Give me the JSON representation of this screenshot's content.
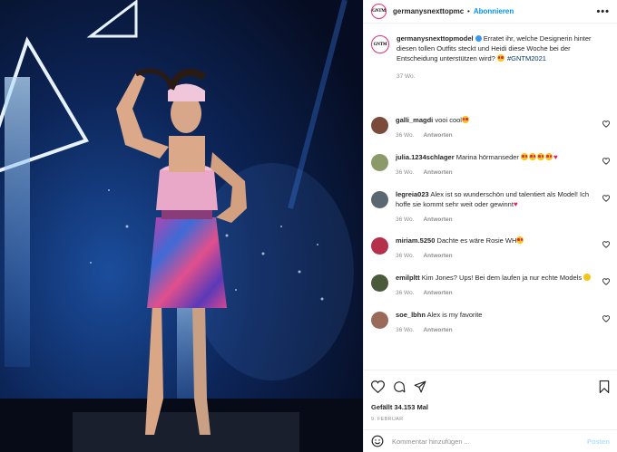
{
  "post": {
    "account": "germanysnexttopmc",
    "account_full": "germanysnexttopmodel",
    "logo_text": "GNTM",
    "follow_label": "Abonnieren",
    "more_label": "•••",
    "caption_text": " Erratet ihr, welche Designerin hinter diesen tollen Outfits steckt und Heidi diese Woche bei der Entscheidung unterstützen wird? ",
    "caption_tag": "#GNTM2021",
    "caption_time": "37 Wo."
  },
  "comments": [
    {
      "user": "galli_magdi",
      "text": " vooi cool",
      "emoji": [
        "eyes"
      ],
      "time": "36 Wo.",
      "reply": "Antworten",
      "avatar": "#7a4b3a"
    },
    {
      "user": "julia.1234schlager",
      "text": " Marina hörmanseder ",
      "emoji": [
        "eyes",
        "eyes",
        "eyes",
        "eyes",
        "heart"
      ],
      "time": "36 Wo.",
      "reply": "Antworten",
      "avatar": "#8c9a6a"
    },
    {
      "user": "legreia023",
      "text": " Alex ist so wunderschön und talentiert als Model! Ich hoffe sie kommt sehr weit oder gewinnt",
      "emoji": [
        "heart"
      ],
      "time": "36 Wo.",
      "reply": "Antworten",
      "avatar": "#5a6670"
    },
    {
      "user": "miriam.5250",
      "text": " Dachte es wäre Rosie WH",
      "emoji": [
        "eyes"
      ],
      "time": "36 Wo.",
      "reply": "Antworten",
      "avatar": "#b5304a"
    },
    {
      "user": "emilpltt",
      "text": " Kim Jones? Ups! Bei dem laufen ja nur echte Models ",
      "emoji": [
        "plain"
      ],
      "time": "36 Wo.",
      "reply": "Antworten",
      "avatar": "#4a5a3a"
    },
    {
      "user": "soe_lbhn",
      "text": " Alex is my favorite",
      "emoji": [],
      "time": "36 Wo.",
      "reply": "Antworten",
      "avatar": "#9a6a5a"
    }
  ],
  "footer": {
    "likes": "Gefällt 34.153 Mal",
    "date": "9. FEBRUAR",
    "comment_placeholder": "Kommentar hinzufügen ...",
    "post_label": "Posten"
  },
  "icons": [
    "heart-icon",
    "comment-icon",
    "share-icon",
    "bookmark-icon",
    "smiley-icon",
    "small-heart-icon",
    "more-icon"
  ],
  "colors": {
    "follow": "#0095f6",
    "muted": "#8e8e8e",
    "post_disabled": "#b2dffc",
    "hashtag": "#00376b"
  }
}
